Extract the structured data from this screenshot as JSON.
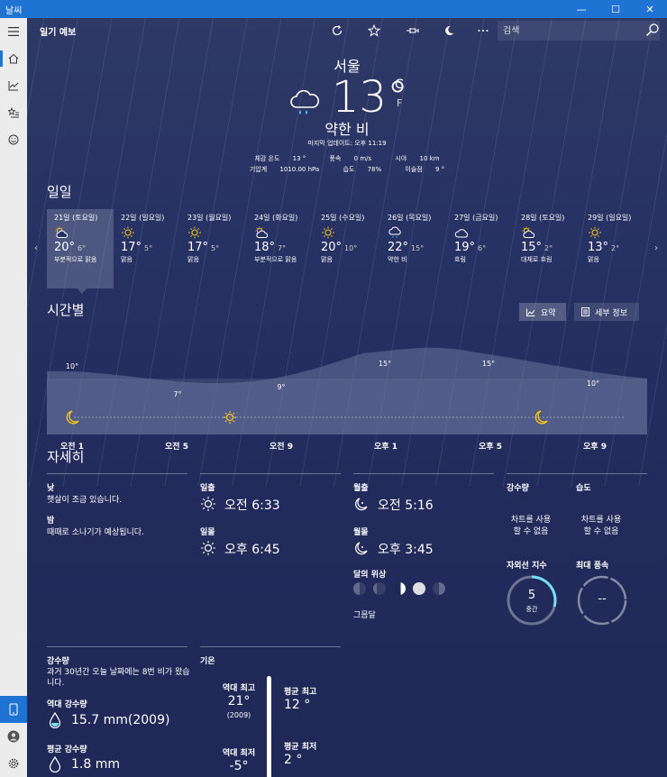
{
  "window": {
    "title": "날씨",
    "min": "—",
    "max": "☐",
    "close": "✕"
  },
  "app": {
    "name": "일기 예보"
  },
  "search": {
    "placeholder": "검색"
  },
  "current": {
    "city": "서울",
    "temp": "13°",
    "unit_c": "C",
    "unit_f": "F",
    "condition": "약한 비",
    "updated": "마지막 업데이트: 오후 11:19",
    "feels_label": "체감 온도",
    "feels": "13 °",
    "wind_label": "풍속",
    "wind": "0 m/s",
    "visibility_label": "시야",
    "visibility": "10 km",
    "pressure_label": "기압계",
    "pressure": "1010.00 hPa",
    "humidity_label": "습도",
    "humidity": "78%",
    "dewpoint_label": "이슬점",
    "dewpoint": "9 °"
  },
  "daily": {
    "title": "일일",
    "days": [
      {
        "name": "21일 (토요일)",
        "hi": "20°",
        "lo": "6°",
        "desc": "부분적으로 맑음",
        "icon": "partly-sunny-icon"
      },
      {
        "name": "22일 (일요일)",
        "hi": "17°",
        "lo": "5°",
        "desc": "맑음",
        "icon": "sun-icon"
      },
      {
        "name": "23일 (월요일)",
        "hi": "17°",
        "lo": "5°",
        "desc": "맑음",
        "icon": "sun-icon"
      },
      {
        "name": "24일 (화요일)",
        "hi": "18°",
        "lo": "7°",
        "desc": "부분적으로 맑음",
        "icon": "partly-sunny-icon"
      },
      {
        "name": "25일 (수요일)",
        "hi": "20°",
        "lo": "10°",
        "desc": "맑음",
        "icon": "sun-icon"
      },
      {
        "name": "26일 (목요일)",
        "hi": "22°",
        "lo": "15°",
        "desc": "약한 비",
        "icon": "rain-icon"
      },
      {
        "name": "27일 (금요일)",
        "hi": "19°",
        "lo": "6°",
        "desc": "흐림",
        "icon": "cloud-icon"
      },
      {
        "name": "28일 (토요일)",
        "hi": "15°",
        "lo": "2°",
        "desc": "대체로 흐림",
        "icon": "partly-sunny-icon"
      },
      {
        "name": "29일 (일요일)",
        "hi": "13°",
        "lo": "2°",
        "desc": "맑음",
        "icon": "sun-icon"
      }
    ]
  },
  "hourly": {
    "title": "시간별",
    "summary_label": "요약",
    "detail_label": "세부 정보",
    "temp_labels": [
      "10°",
      "7°",
      "9°",
      "15°",
      "15°",
      "10°"
    ],
    "times": [
      "오전 1",
      "오전 5",
      "오전 9",
      "오후 1",
      "오후 5",
      "오후 9"
    ]
  },
  "details": {
    "title": "자세히",
    "day_label": "낮",
    "day_text": "햇살이 조금 있습니다.",
    "night_label": "밤",
    "night_text": "때때로 소나기가 예상됩니다.",
    "sunrise_label": "일출",
    "sunrise": "오전 6:33",
    "sunset_label": "일몰",
    "sunset": "오후 6:45",
    "moonrise_label": "월출",
    "moonrise": "오전 5:16",
    "moonset_label": "월몰",
    "moonset": "오후 3:45",
    "moonphase_label": "달의 위상",
    "moonphase": "그믐달",
    "precip_label": "강수량",
    "precip_text": "차트를 사용\n할 수 없음",
    "humidity_label": "습도",
    "humidity_text": "차트를 사용\n할 수 없음",
    "uv_label": "자외선 지수",
    "uv_value": "5",
    "uv_desc": "중간",
    "maxwind_label": "최대 풍속",
    "maxwind_value": "--"
  },
  "climate": {
    "precip_title": "강수량",
    "precip_text": "과거 30년간 오늘 날짜에는 8번 비가 왔습니다.",
    "record_precip_label": "역대 강수량",
    "record_precip": "15.7 mm(2009)",
    "avg_precip_label": "평균 강수량",
    "avg_precip": "1.8 mm",
    "temp_title": "기온",
    "record_high_label": "역대 최고",
    "record_high": "21°",
    "record_high_year": "(2009)",
    "record_low_label": "역대 최저",
    "record_low": "-5°",
    "avg_high_label": "평균 최고",
    "avg_high": "12 °",
    "avg_low_label": "평균 최저",
    "avg_low": "2 °"
  },
  "colors": {
    "accent": "#1f74d3",
    "background": "#1f2a55",
    "sun": "#f5c518",
    "uv_ring": "#6fe0f5"
  }
}
